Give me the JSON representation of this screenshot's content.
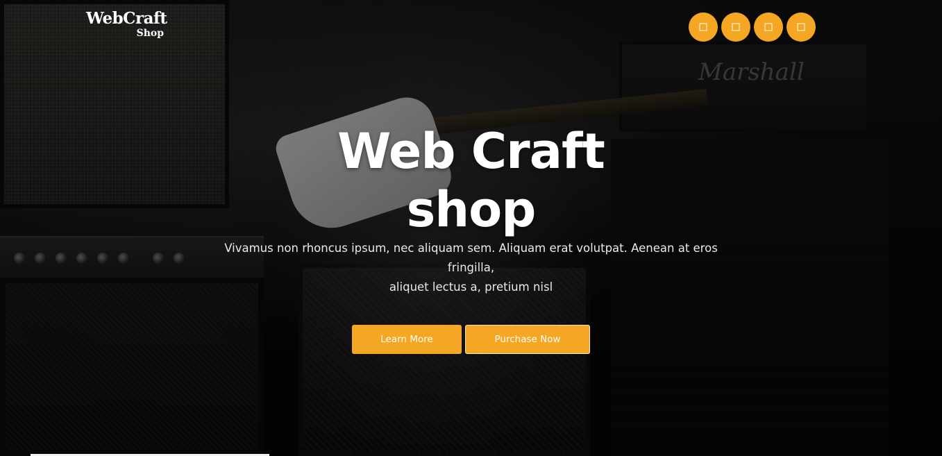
{
  "header": {
    "logo": {
      "main": "WebCraft",
      "sub": "Shop"
    },
    "social": [
      {
        "icon": "facebook-icon"
      },
      {
        "icon": "twitter-icon"
      },
      {
        "icon": "instagram-icon"
      },
      {
        "icon": "linkedin-icon"
      }
    ]
  },
  "hero": {
    "title_line1": "Web Craft",
    "title_line2": "shop",
    "text_line1": "Vivamus non rhoncus ipsum, nec aliquam sem. Aliquam erat volutpat. Aenean at eros fringilla,",
    "text_line2": "aliquet lectus a, pretium nisl",
    "buttons": {
      "learn_more": "Learn More",
      "purchase_now": "Purchase Now"
    }
  },
  "background": {
    "amp_brand": "Marshall"
  },
  "colors": {
    "accent": "#f5a623",
    "text": "#ffffff",
    "background": "#050505"
  }
}
